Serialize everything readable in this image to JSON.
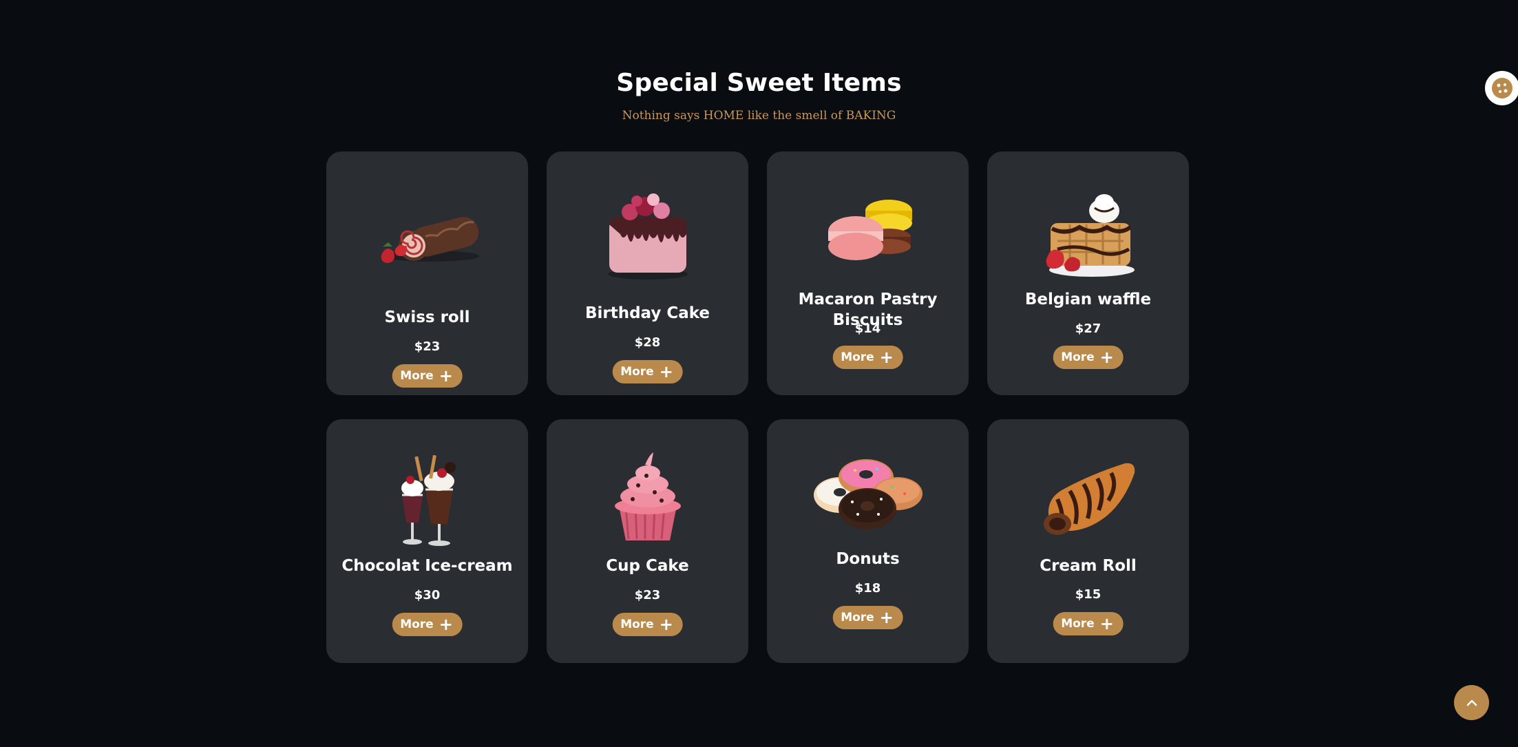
{
  "section": {
    "title": "Special Sweet Items",
    "subtitle": "Nothing says HOME like the smell of BAKING"
  },
  "products": [
    {
      "name": "Swiss roll",
      "price": "$23",
      "button": "More",
      "icon": "swiss-roll-icon"
    },
    {
      "name": "Birthday Cake",
      "price": "$28",
      "button": "More",
      "icon": "birthday-cake-icon"
    },
    {
      "name": "Macaron Pastry Biscuits",
      "price": "$14",
      "button": "More",
      "icon": "macaron-icon"
    },
    {
      "name": "Belgian waffle",
      "price": "$27",
      "button": "More",
      "icon": "waffle-icon"
    },
    {
      "name": "Chocolat Ice-cream",
      "price": "$30",
      "button": "More",
      "icon": "ice-cream-icon"
    },
    {
      "name": "Cup Cake",
      "price": "$23",
      "button": "More",
      "icon": "cupcake-icon"
    },
    {
      "name": "Donuts",
      "price": "$18",
      "button": "More",
      "icon": "donuts-icon"
    },
    {
      "name": "Cream Roll",
      "price": "$15",
      "button": "More",
      "icon": "cream-roll-icon"
    }
  ],
  "colors": {
    "background": "#090d12",
    "card": "#2a2d31",
    "accent": "#b98a4b",
    "subtitle": "#c8975a"
  },
  "floating": {
    "cookie_icon": "cookie-icon",
    "scroll_icon": "chevron-up-icon"
  }
}
